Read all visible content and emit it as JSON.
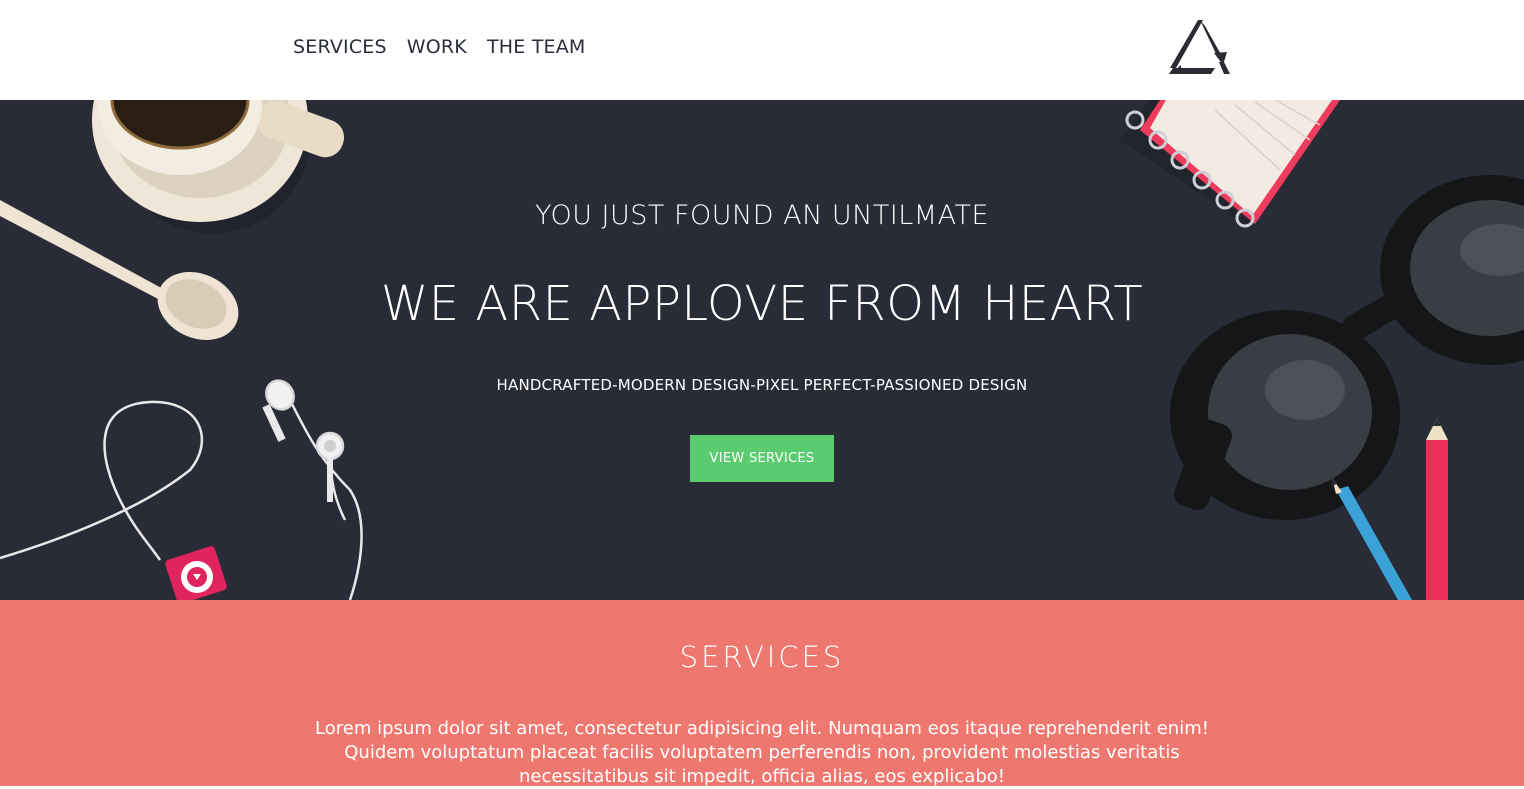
{
  "nav": {
    "links": [
      {
        "label": "SERVICES"
      },
      {
        "label": "WORK"
      },
      {
        "label": "THE TEAM"
      }
    ],
    "logo_icon": "triangle-arrows-logo-icon"
  },
  "hero": {
    "kicker": "YOU JUST FOUND AN UNTILMATE",
    "title": "WE ARE APPLOVE FROM HEART",
    "tagline": "HANDCRAFTED-MODERN DESIGN-PIXEL PERFECT-PASSIONED DESIGN",
    "button_label": "VIEW SERVICES",
    "background_color": "#292c36",
    "button_color": "#5acb6e",
    "illustration_icons": [
      "coffee-cup-icon",
      "spoon-icon",
      "earphones-icon",
      "music-player-icon",
      "notebook-icon",
      "glasses-icon",
      "pencil-icon"
    ]
  },
  "services": {
    "heading": "SERVICES",
    "text_line1": "Lorem ipsum dolor sit amet, consectetur adipisicing elit. Numquam eos itaque reprehenderit enim!",
    "text_line2": "Quidem voluptatum placeat facilis voluptatem perferendis non, provident molestias veritatis",
    "text_line3": "necessitatibus sit impedit, officia alias, eos explicabo!",
    "background_color": "#ee786f"
  }
}
